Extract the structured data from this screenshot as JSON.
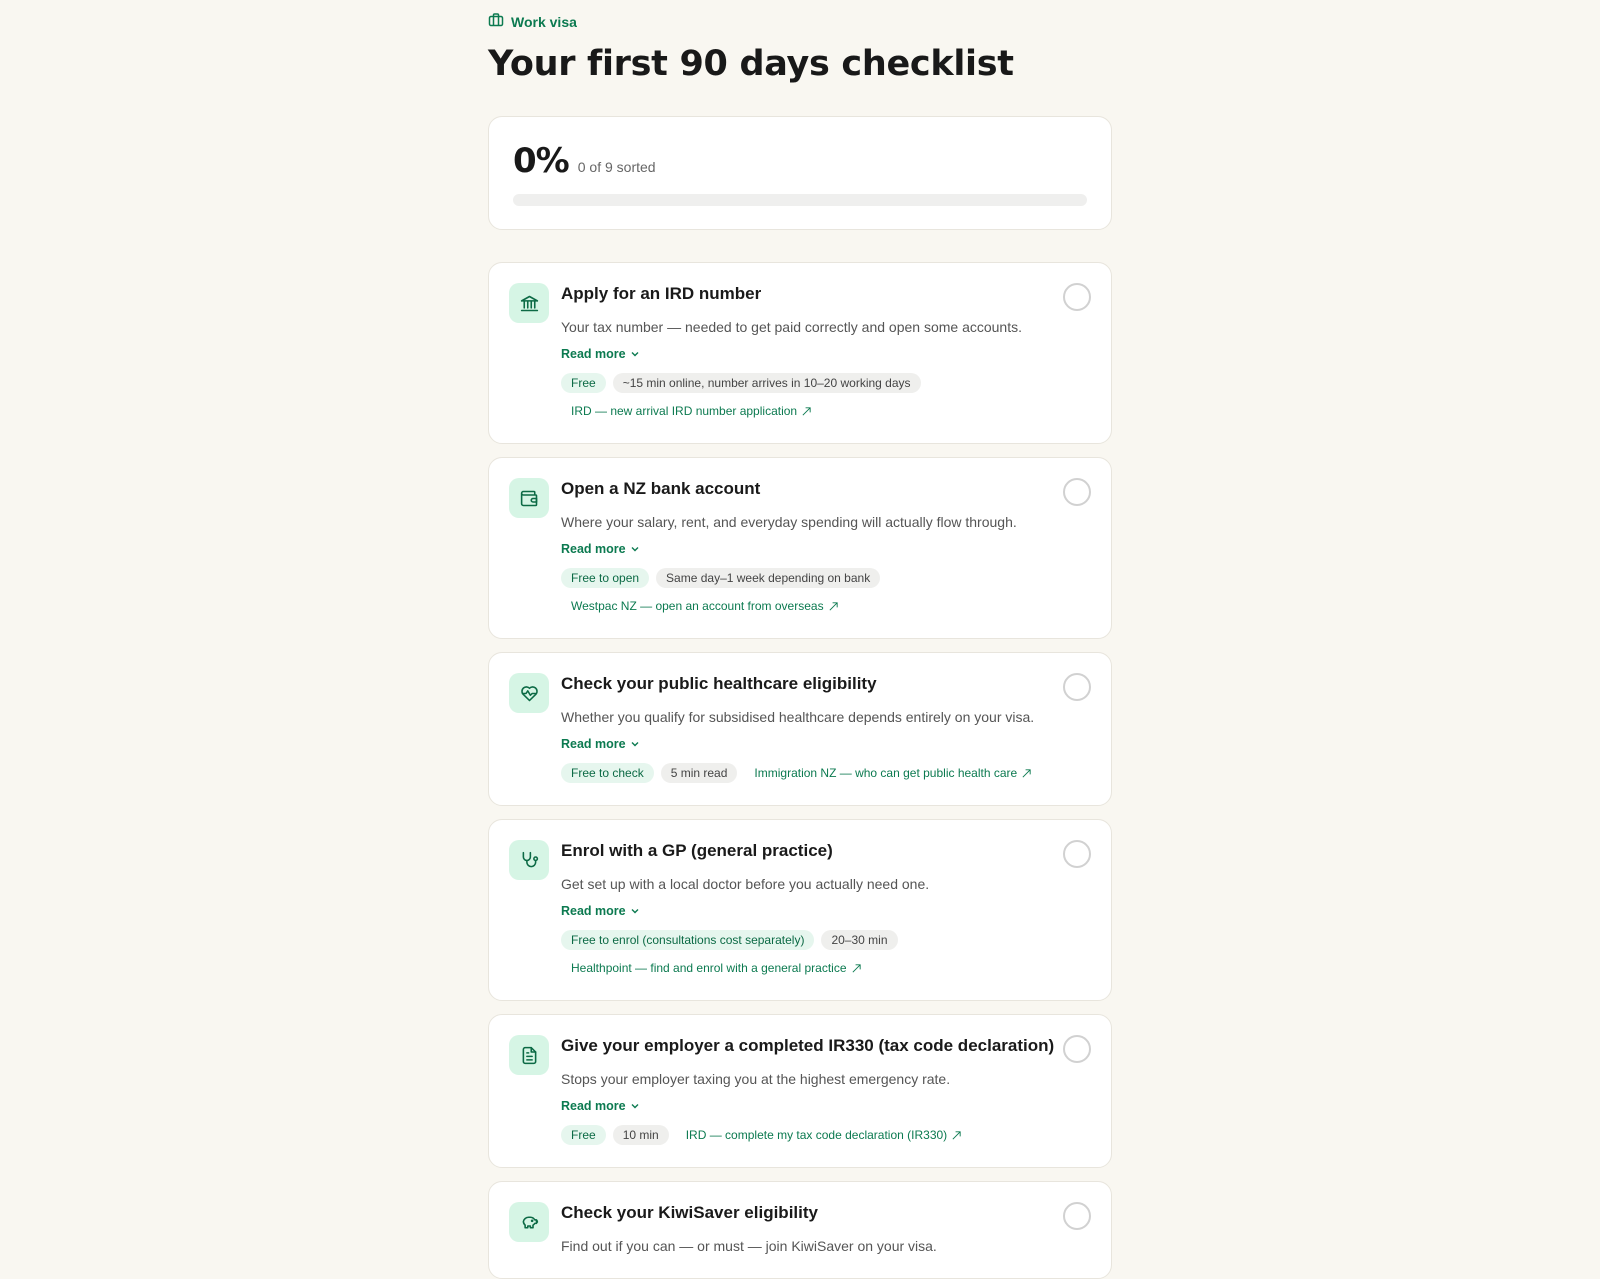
{
  "header": {
    "eyebrow": "Work visa",
    "eyebrow_icon": "briefcase-icon",
    "title": "Your first 90 days checklist"
  },
  "progress": {
    "percent_label": "0%",
    "sorted_label": "0 of 9 sorted",
    "fraction": 0
  },
  "colors": {
    "accent": "#0c7a50",
    "background": "#f9f7f1",
    "icon_bg": "#d6f5e5"
  },
  "tasks": [
    {
      "icon": "bank-icon",
      "title": "Apply for an IRD number",
      "desc": "Your tax number — needed to get paid correctly and open some accounts.",
      "read_more": "Read more",
      "cost": "Free",
      "time": "~15 min online, number arrives in 10–20 working days",
      "link": "IRD — new arrival IRD number application",
      "link_icon": "external-arrow-icon"
    },
    {
      "icon": "wallet-icon",
      "title": "Open a NZ bank account",
      "desc": "Where your salary, rent, and everyday spending will actually flow through.",
      "read_more": "Read more",
      "cost": "Free to open",
      "time": "Same day–1 week depending on bank",
      "link": "Westpac NZ — open an account from overseas",
      "link_icon": "external-arrow-icon"
    },
    {
      "icon": "heart-pulse-icon",
      "title": "Check your public healthcare eligibility",
      "desc": "Whether you qualify for subsidised healthcare depends entirely on your visa.",
      "read_more": "Read more",
      "cost": "Free to check",
      "time": "5 min read",
      "link": "Immigration NZ — who can get public health care",
      "link_icon": "external-arrow-icon"
    },
    {
      "icon": "stethoscope-icon",
      "title": "Enrol with a GP (general practice)",
      "desc": "Get set up with a local doctor before you actually need one.",
      "read_more": "Read more",
      "cost": "Free to enrol (consultations cost separately)",
      "time": "20–30 min",
      "link": "Healthpoint — find and enrol with a general practice",
      "link_icon": "external-arrow-icon"
    },
    {
      "icon": "document-icon",
      "title": "Give your employer a completed IR330 (tax code declaration)",
      "desc": "Stops your employer taxing you at the highest emergency rate.",
      "read_more": "Read more",
      "cost": "Free",
      "time": "10 min",
      "link": "IRD — complete my tax code declaration (IR330)",
      "link_icon": "external-arrow-icon"
    },
    {
      "icon": "piggy-bank-icon",
      "title": "Check your KiwiSaver eligibility",
      "desc": "Find out if you can — or must — join KiwiSaver on your visa."
    }
  ]
}
